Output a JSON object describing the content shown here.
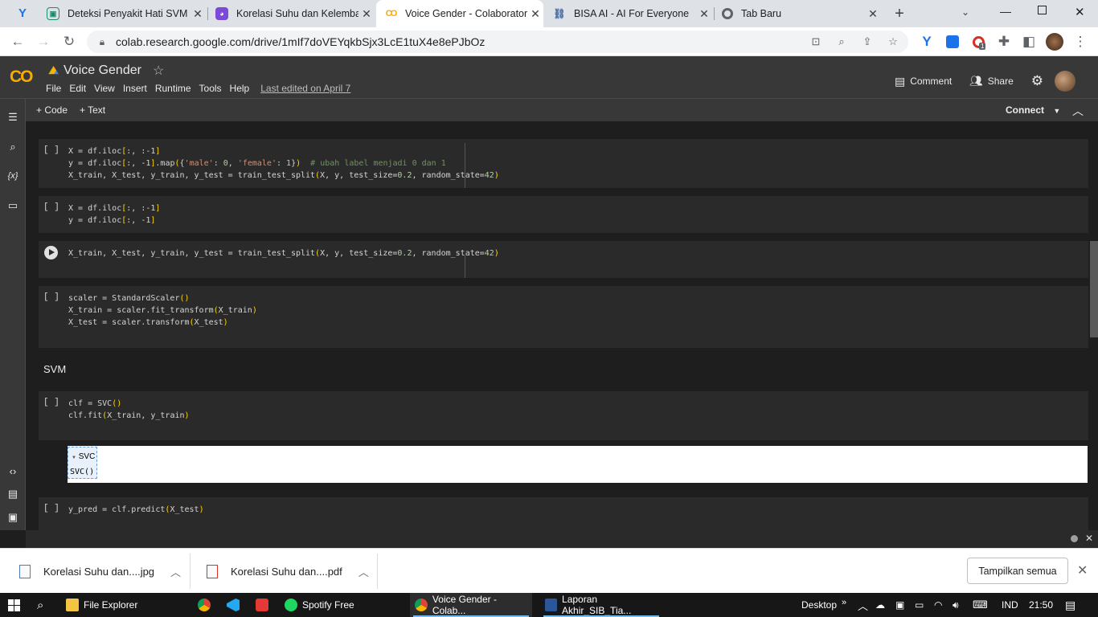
{
  "browser": {
    "tabs": [
      {
        "title": "Deteksi Penyakit Hati SVM",
        "icon": "colab-icon"
      },
      {
        "title": "Korelasi Suhu dan Kelemba",
        "icon": "extension-icon"
      },
      {
        "title": "Voice Gender - Colaboratory",
        "icon": "colab-icon"
      },
      {
        "title": "BISA AI - AI For Everyone",
        "icon": "bisa-ai-icon"
      },
      {
        "title": "Tab Baru",
        "icon": "chrome-icon"
      }
    ],
    "url": "colab.research.google.com/drive/1mIf7doVEYqkbSjx3LcE1tuX4e8ePJbOz",
    "profile_badge": "1"
  },
  "colab": {
    "logo": "CO",
    "title": "Voice Gender",
    "menu": [
      "File",
      "Edit",
      "View",
      "Insert",
      "Runtime",
      "Tools",
      "Help"
    ],
    "last_edited": "Last edited on April 7",
    "comment_label": "Comment",
    "share_label": "Share",
    "add_code": "Code",
    "add_text": "Text",
    "connect_label": "Connect",
    "variables_icon": "{x}"
  },
  "cells": {
    "c1": {
      "run": "[ ]"
    },
    "c2": {
      "run": "[ ]"
    },
    "c4": {
      "run": "[ ]"
    },
    "c5": {
      "run": "[ ]"
    },
    "c6": {
      "run": "[ ]"
    },
    "section_svm": "SVM",
    "output": {
      "widget_label": "SVC",
      "repr": "SVC()"
    }
  },
  "downloads": [
    {
      "name": "Korelasi Suhu dan....jpg"
    },
    {
      "name": "Korelasi Suhu dan....pdf"
    }
  ],
  "show_all": "Tampilkan semua",
  "taskbar": {
    "apps": [
      "File Explorer",
      "Spotify Free",
      "Voice Gender - Colab...",
      "Laporan Akhir_SIB_Tia..."
    ],
    "desktop": "Desktop",
    "lang": "IND",
    "time": "21:50"
  },
  "colors": {
    "colab_orange": "#f9ab00",
    "cell_bg": "#2a2a2a",
    "header_bg": "#383838"
  }
}
